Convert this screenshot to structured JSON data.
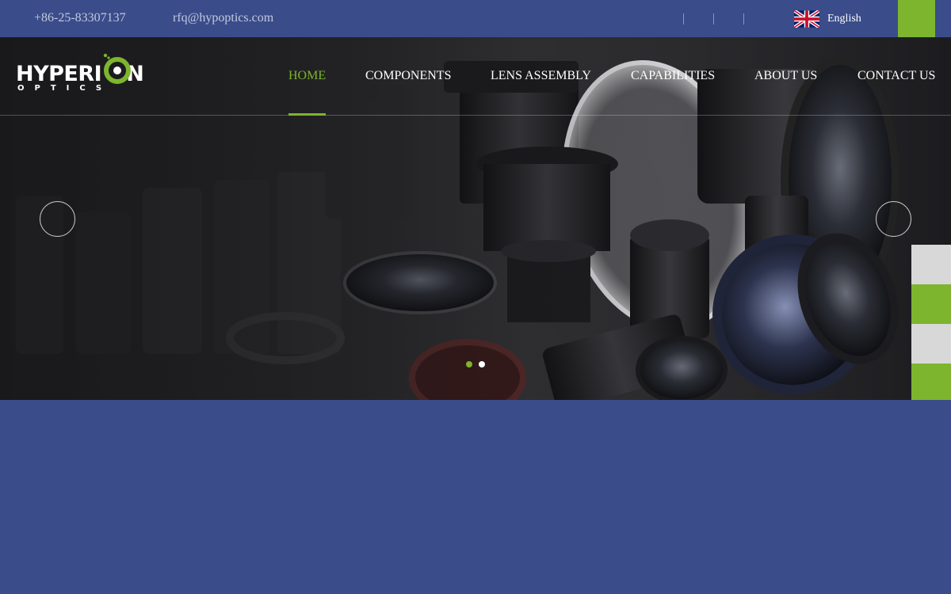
{
  "topbar": {
    "phone": "+86-25-83307137",
    "email": "rfq@hypoptics.com",
    "language": "English",
    "flag_icon": "uk-flag-icon"
  },
  "logo": {
    "word1": "HYPERI",
    "word1_tail": "N",
    "word2": "OPTICS"
  },
  "nav": {
    "items": [
      {
        "label": "HOME",
        "active": true
      },
      {
        "label": "COMPONENTS",
        "active": false
      },
      {
        "label": "LENS ASSEMBLY",
        "active": false
      },
      {
        "label": "CAPABILITIES",
        "active": false
      },
      {
        "label": "ABOUT US",
        "active": false
      },
      {
        "label": "CONTACT US",
        "active": false
      }
    ]
  },
  "slider": {
    "slide_count": 2,
    "active_slide": 1
  },
  "colors": {
    "primary_blue": "#3a4c8a",
    "accent_green": "#7db52e",
    "side_tab_gray": "#d8d8d8"
  }
}
